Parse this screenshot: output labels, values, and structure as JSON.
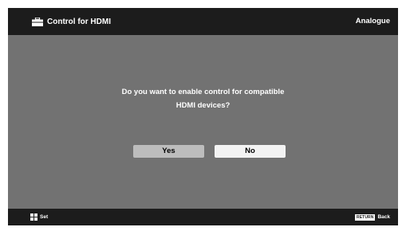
{
  "header": {
    "icon": "toolbox-icon",
    "title": "Control for HDMI",
    "source": "Analogue"
  },
  "dialog": {
    "question_line1": "Do you want to enable control for compatible",
    "question_line2": "HDMI devices?",
    "yes_label": "Yes",
    "no_label": "No",
    "selected": "Yes"
  },
  "footer": {
    "set_icon": "dpad-icon",
    "set_label": "Set",
    "return_key": "RETURN",
    "back_label": "Back"
  },
  "colors": {
    "bar_background": "#1c1c1c",
    "content_background": "#727272",
    "selected_button": "#bdbdbd",
    "unselected_button": "#f3f3f3",
    "text": "#ffffff"
  }
}
